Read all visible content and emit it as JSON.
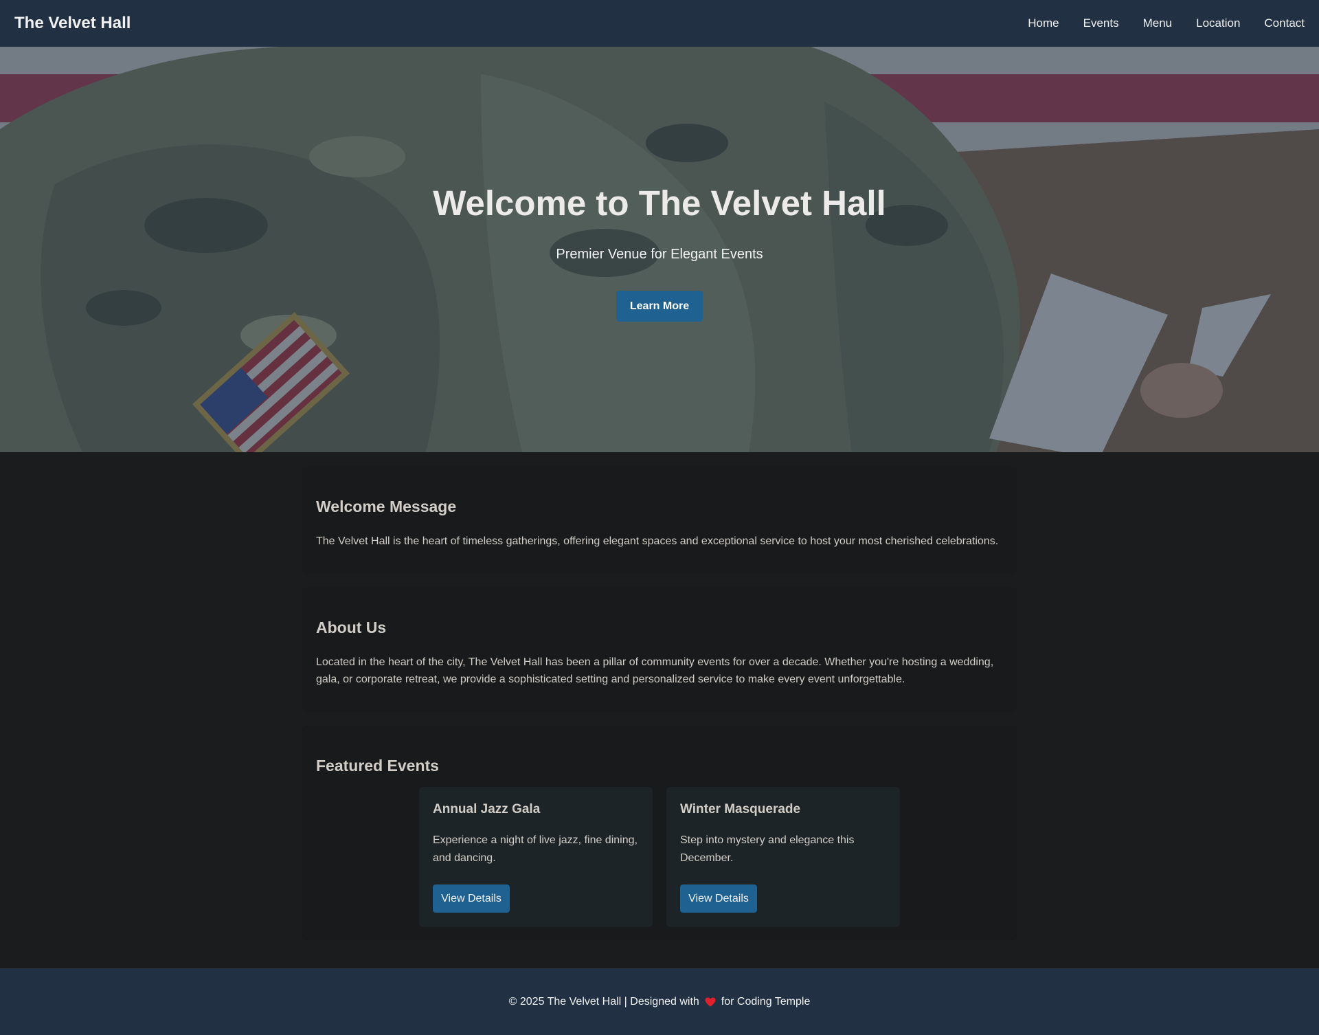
{
  "navbar": {
    "brand": "The Velvet Hall",
    "links": [
      "Home",
      "Events",
      "Menu",
      "Location",
      "Contact"
    ]
  },
  "hero": {
    "title": "Welcome to The Velvet Hall",
    "subtitle": "Premier Venue for Elegant Events",
    "button_label": "Learn More",
    "overlay_color": "#213143"
  },
  "welcome": {
    "title": "Welcome Message",
    "text": "The Velvet Hall is the heart of timeless gatherings, offering elegant spaces and exceptional service to host your most cherished celebrations."
  },
  "about": {
    "title": "About Us",
    "text": "Located in the heart of the city, The Velvet Hall has been a pillar of community events for over a decade. Whether you're hosting a wedding, gala, or corporate retreat, we provide a sophisticated setting and personalized service to make every event unforgettable."
  },
  "featured": {
    "title": "Featured Events",
    "events": [
      {
        "title": "Annual Jazz Gala",
        "description": "Experience a night of live jazz, fine dining, and dancing.",
        "button_label": "View Details"
      },
      {
        "title": "Winter Masquerade",
        "description": "Step into mystery and elegance this December.",
        "button_label": "View Details"
      }
    ]
  },
  "footer": {
    "text_before": "© 2025 The Velvet Hall | Designed with",
    "icon": "heart-icon",
    "text_after": "for Coding Temple"
  },
  "colors": {
    "navbar_bg": "#213143",
    "page_bg": "#1b1c1e",
    "card_bg": "#181a1b",
    "event_card_bg": "#1c2427",
    "accent_button": "#1f6191",
    "heart": "#e0212b"
  }
}
